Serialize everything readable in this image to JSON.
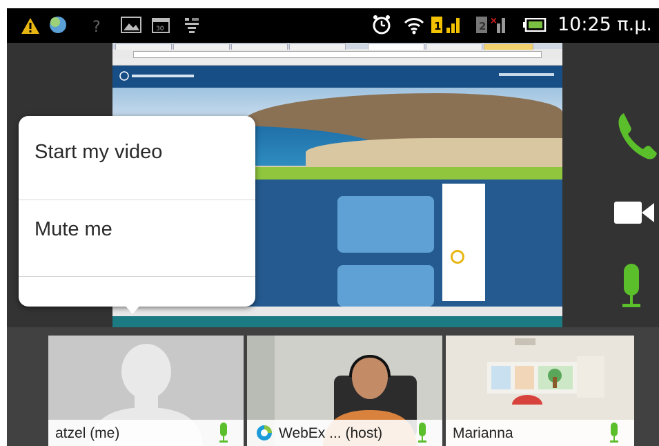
{
  "status_bar": {
    "time": "10:25 π.μ.",
    "left_icons": [
      "warning-icon",
      "app-icon",
      "wifi-question-icon",
      "gallery-icon",
      "calendar-icon",
      "usb-icon"
    ],
    "right_icons": [
      "alarm-icon",
      "wifi-icon",
      "sim1-signal-icon",
      "sim2-no-signal-icon",
      "battery-icon"
    ]
  },
  "context_menu": {
    "items": [
      "Start my video",
      "Mute me"
    ]
  },
  "controls": [
    "call-icon",
    "video-camera-icon",
    "microphone-icon"
  ],
  "participants": [
    {
      "name": "atzel (me)",
      "type": "placeholder-avatar"
    },
    {
      "name": "WebEx ... (host)",
      "type": "video",
      "has_webex_logo": true
    },
    {
      "name": "Marianna",
      "type": "video"
    }
  ],
  "colors": {
    "accent_green": "#5bbf2b",
    "dock_background": "#414141",
    "menu_background": "#ffffff"
  }
}
